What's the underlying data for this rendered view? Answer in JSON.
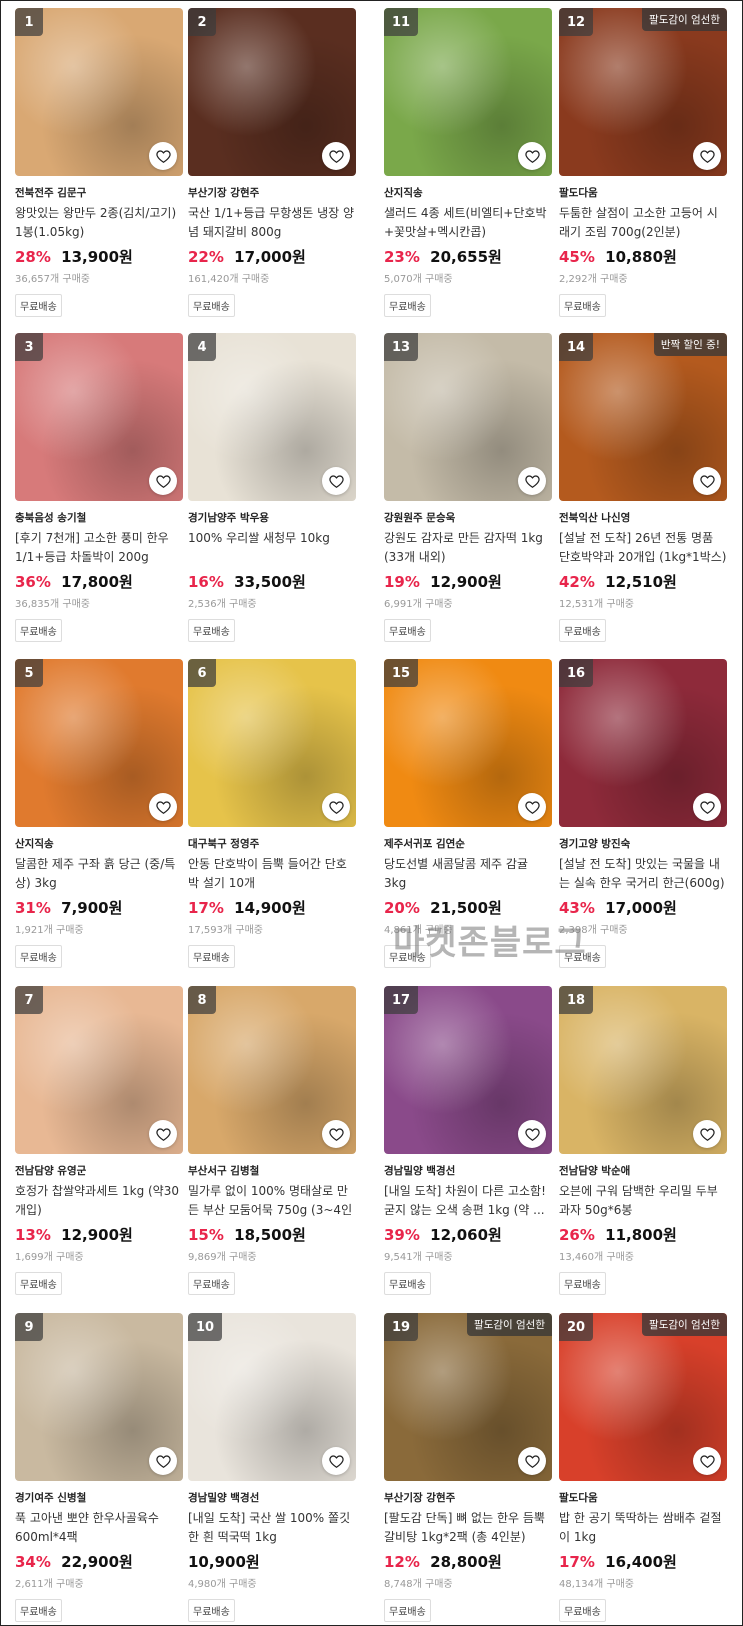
{
  "products": [
    {
      "rank": "1",
      "seller": "전북전주 김문구",
      "title": "왕맛있는 왕만두 2종(김치/고기) 1봉(1.05kg)",
      "discount": "28%",
      "price": "13,900원",
      "buyers": "36,657개 구매중",
      "shipping": "무료배송",
      "badge": "",
      "image_icon": "dumpling-photo",
      "color": "#d9a873"
    },
    {
      "rank": "2",
      "seller": "부산기장 강현주",
      "title": "국산 1/1+등급 무항생돈 냉장 양념 돼지갈비 800g",
      "discount": "22%",
      "price": "17,000원",
      "buyers": "161,420개 구매중",
      "shipping": "무료배송",
      "badge": "",
      "image_icon": "pork-ribs-photo",
      "color": "#5a2e20"
    },
    {
      "rank": "11",
      "seller": "산지직송",
      "title": "샐러드 4종 세트(비엘티+단호박+꽃맛살+멕시칸콥)",
      "discount": "23%",
      "price": "20,655원",
      "buyers": "5,070개 구매중",
      "shipping": "무료배송",
      "badge": "",
      "image_icon": "salad-photo",
      "color": "#7aa84a"
    },
    {
      "rank": "12",
      "seller": "팔도다움",
      "title": "두툼한 살점이 고소한 고등어 시래기 조림 700g(2인분)",
      "discount": "45%",
      "price": "10,880원",
      "buyers": "2,292개 구매중",
      "shipping": "무료배송",
      "badge": "팔도감이 엄선한",
      "image_icon": "mackerel-stew-photo",
      "color": "#8a3a1e"
    },
    {
      "rank": "3",
      "seller": "충북음성 송기철",
      "title": "[후기 7천개] 고소한 풍미 한우 1/1+등급 차돌박이 200g",
      "discount": "36%",
      "price": "17,800원",
      "buyers": "36,835개 구매중",
      "shipping": "무료배송",
      "badge": "",
      "image_icon": "beef-brisket-photo",
      "color": "#d77a7a"
    },
    {
      "rank": "4",
      "seller": "경기남양주 박우용",
      "title": "100% 우리쌀 새청무  10kg",
      "discount": "16%",
      "price": "33,500원",
      "buyers": "2,536개 구매중",
      "shipping": "무료배송",
      "badge": "",
      "image_icon": "rice-photo",
      "color": "#e8e2d6"
    },
    {
      "rank": "13",
      "seller": "강원원주 문승욱",
      "title": "강원도 감자로 만든 감자떡 1kg (33개 내외)",
      "discount": "19%",
      "price": "12,900원",
      "buyers": "6,991개 구매중",
      "shipping": "무료배송",
      "badge": "",
      "image_icon": "potato-rice-cake-photo",
      "color": "#c4bba8"
    },
    {
      "rank": "14",
      "seller": "전북익산 나신영",
      "title": "[설날 전 도착] 26년 전통 명품 단호박약과 20개입 (1kg*1박스)",
      "discount": "42%",
      "price": "12,510원",
      "buyers": "12,531개 구매중",
      "shipping": "무료배송",
      "badge": "반짝 할인 중!",
      "image_icon": "yakgwa-photo",
      "color": "#b45a1e"
    },
    {
      "rank": "5",
      "seller": "산지직송",
      "title": "달콤한 제주 구좌 흙 당근 (중/특상) 3kg",
      "discount": "31%",
      "price": "7,900원",
      "buyers": "1,921개 구매중",
      "shipping": "무료배송",
      "badge": "",
      "image_icon": "carrot-photo",
      "color": "#e07a2e"
    },
    {
      "rank": "6",
      "seller": "대구북구 정영주",
      "title": "안동 단호박이 듬뿍 들어간 단호박 설기 10개",
      "discount": "17%",
      "price": "14,900원",
      "buyers": "17,593개 구매중",
      "shipping": "무료배송",
      "badge": "",
      "image_icon": "pumpkin-cake-photo",
      "color": "#e6c34a"
    },
    {
      "rank": "15",
      "seller": "제주서귀포 김연순",
      "title": "당도선별 새콤달콤 제주 감귤 3kg",
      "discount": "20%",
      "price": "21,500원",
      "buyers": "4,861개 구매중",
      "shipping": "무료배송",
      "badge": "",
      "image_icon": "tangerine-photo",
      "color": "#f08a12"
    },
    {
      "rank": "16",
      "seller": "경기고양 방진숙",
      "title": "[설날 전 도착] 맛있는 국물을 내는 실속 한우 국거리 한근(600g)",
      "discount": "43%",
      "price": "17,000원",
      "buyers": "2,398개 구매중",
      "shipping": "무료배송",
      "badge": "",
      "image_icon": "beef-soup-cut-photo",
      "color": "#8e2a3a"
    },
    {
      "rank": "7",
      "seller": "전남담양 유영군",
      "title": "호정가 찹쌀약과세트 1kg (약30개입)",
      "discount": "13%",
      "price": "12,900원",
      "buyers": "1,699개 구매중",
      "shipping": "무료배송",
      "badge": "",
      "image_icon": "yakgwa-pack-photo",
      "color": "#e8b894"
    },
    {
      "rank": "8",
      "seller": "부산서구 김병철",
      "title": "밀가루 없이 100% 명태살로 만든 부산 모둠어묵 750g (3~4인분)",
      "discount": "15%",
      "price": "18,500원",
      "buyers": "9,869개 구매중",
      "shipping": "무료배송",
      "badge": "",
      "image_icon": "fish-cake-photo",
      "color": "#d8a86a"
    },
    {
      "rank": "17",
      "seller": "경남밀양 백경선",
      "title": "[내일 도착] 차원이 다른 고소함! 굳지 않는 오색 송편 1kg (약 ...",
      "discount": "39%",
      "price": "12,060원",
      "buyers": "9,541개 구매중",
      "shipping": "무료배송",
      "badge": "",
      "image_icon": "songpyeon-photo",
      "color": "#8a4a8a"
    },
    {
      "rank": "18",
      "seller": "전남담양 박순애",
      "title": "오븐에 구워 담백한 우리밀 두부과자 50g*6봉",
      "discount": "26%",
      "price": "11,800원",
      "buyers": "13,460개 구매중",
      "shipping": "무료배송",
      "badge": "",
      "image_icon": "tofu-cracker-photo",
      "color": "#d9b465"
    },
    {
      "rank": "9",
      "seller": "경기여주 신병철",
      "title": "푹 고아낸 뽀얀 한우사골육수 600ml*4팩",
      "discount": "34%",
      "price": "22,900원",
      "buyers": "2,611개 구매중",
      "shipping": "무료배송",
      "badge": "",
      "image_icon": "bone-broth-pack-photo",
      "color": "#c9b9a0"
    },
    {
      "rank": "10",
      "seller": "경남밀양 백경선",
      "title": "[내일 도착] 국산 쌀 100% 쫄깃한 흰 떡국떡 1kg",
      "discount": "",
      "price": "10,900원",
      "buyers": "4,980개 구매중",
      "shipping": "무료배송",
      "badge": "",
      "image_icon": "rice-cake-slices-photo",
      "color": "#e9e4dc"
    },
    {
      "rank": "19",
      "seller": "부산기장 강현주",
      "title": "[팔도감 단독] 뼈 없는 한우 듬뿍 갈비탕 1kg*2팩 (총 4인분)",
      "discount": "12%",
      "price": "28,800원",
      "buyers": "8,748개 구매중",
      "shipping": "무료배송",
      "badge": "팔도감이 엄선한",
      "image_icon": "galbitang-photo",
      "color": "#8a6a3a"
    },
    {
      "rank": "20",
      "seller": "팔도다움",
      "title": "밥 한 공기 뚝딱하는 쌈배추 겉절이 1kg",
      "discount": "17%",
      "price": "16,400원",
      "buyers": "48,134개 구매중",
      "shipping": "무료배송",
      "badge": "팔도감이 엄선한",
      "image_icon": "kimchi-photo",
      "color": "#d8402a"
    }
  ],
  "watermark": "마켓존블로그",
  "heart_icon": "heart-outline-icon"
}
